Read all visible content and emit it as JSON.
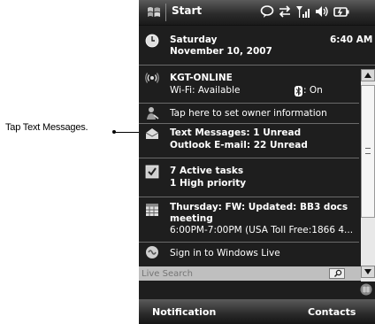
{
  "callout": {
    "text": "Tap Text Messages."
  },
  "titlebar": {
    "start_label": "Start",
    "icons": [
      "windows-flag-icon",
      "speech-bubble-icon",
      "sync-arrows-icon",
      "signal-strength-icon",
      "speaker-icon",
      "battery-icon"
    ]
  },
  "today": {
    "date": {
      "weekday": "Saturday",
      "date": "November 10, 2007",
      "time": "6:40 AM"
    },
    "wifi": {
      "network": "KGT-ONLINE",
      "status": "Wi-Fi: Available",
      "bluetooth": ": On"
    },
    "owner": {
      "text": "Tap here to set owner information"
    },
    "messages": {
      "text_messages": "Text Messages: 1 Unread",
      "email": "Outlook E-mail: 22 Unread"
    },
    "tasks": {
      "active": "7 Active tasks",
      "priority": "1 High priority"
    },
    "calendar": {
      "title_line1": "Thursday: FW: Updated: BB3 docs",
      "title_line2": "meeting",
      "detail": "6:00PM-7:00PM (USA Toll Free:1866 4..."
    },
    "live": {
      "text": "Sign in to Windows Live"
    },
    "search": {
      "placeholder": "Live Search"
    }
  },
  "softkeys": {
    "left": "Notification",
    "right": "Contacts"
  }
}
